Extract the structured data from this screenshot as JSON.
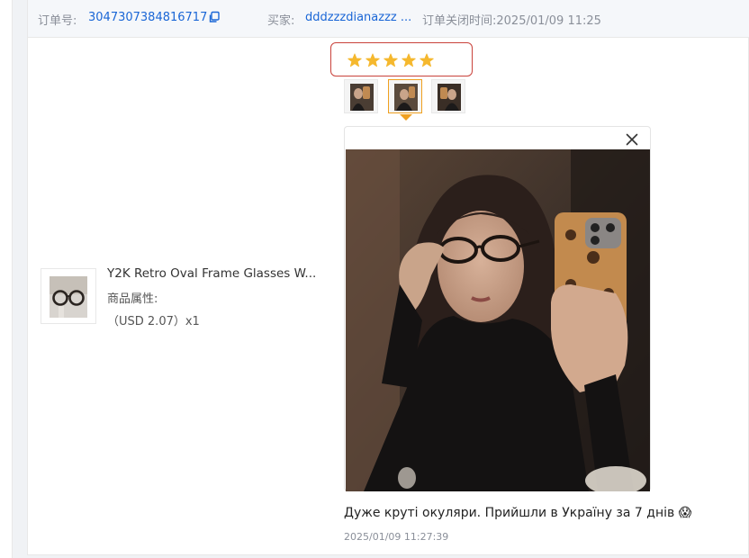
{
  "header": {
    "order_label": "订单号:",
    "order_number": "3047307384816717",
    "buyer_label": "买家:",
    "buyer_name": "dddzzzdianazzz ...",
    "close_time": "订单关闭时间:2025/01/09 11:25",
    "link_color": "#1a66d6"
  },
  "product": {
    "title": "Y2K Retro Oval Frame Glasses W...",
    "attributes_label": "商品属性:",
    "price": "（USD  2.07）x1",
    "thumbnail_icon": "glasses-photo"
  },
  "review": {
    "rating": 5,
    "max_rating": 5,
    "star_color": "#f5b82e",
    "highlight_border_color": "#c9423b",
    "photo_thumbnails": [
      "mirror-selfie-1",
      "mirror-selfie-2",
      "mirror-selfie-3"
    ],
    "selected_thumbnail": 2,
    "active_thumb_color": "#f0a020",
    "text": "Дуже круті окуляри. Прийшли в Україну за 7 днів 😱",
    "date": "2025/01/09 11:27:39"
  }
}
